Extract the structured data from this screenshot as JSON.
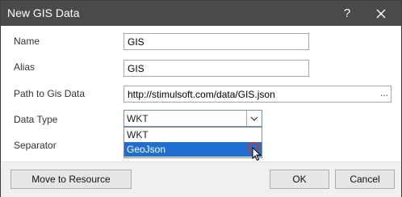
{
  "window": {
    "title": "New GIS Data",
    "help_glyph": "?"
  },
  "fields": {
    "name": {
      "label": "Name",
      "value": "GIS"
    },
    "alias": {
      "label": "Alias",
      "value": "GIS"
    },
    "path": {
      "label": "Path to Gis Data",
      "value": "http://stimulsoft.com/data/GIS.json",
      "browse_glyph": "..."
    },
    "data_type": {
      "label": "Data Type",
      "value": "WKT",
      "options": [
        "WKT",
        "GeoJson"
      ],
      "highlighted": "GeoJson"
    },
    "separator": {
      "label": "Separator"
    }
  },
  "buttons": {
    "move_to_resource": "Move to Resource",
    "ok": "OK",
    "cancel": "Cancel"
  },
  "colors": {
    "titlebar": "#4a4a4a",
    "selection": "#1f6fd2",
    "cursor_ring": "#c0392b"
  },
  "icons": [
    "close-icon",
    "chevron-down-icon",
    "mouse-pointer-icon"
  ]
}
